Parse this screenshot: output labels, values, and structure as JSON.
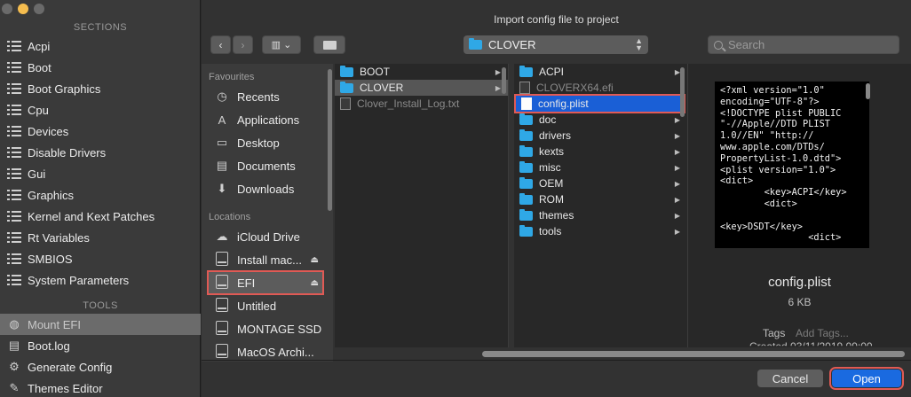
{
  "app_sidebar": {
    "sections_heading": "SECTIONS",
    "sections": [
      "Acpi",
      "Boot",
      "Boot Graphics",
      "Cpu",
      "Devices",
      "Disable Drivers",
      "Gui",
      "Graphics",
      "Kernel and Kext Patches",
      "Rt Variables",
      "SMBIOS",
      "System Parameters"
    ],
    "tools_heading": "TOOLS",
    "tools": [
      {
        "label": "Mount EFI",
        "icon": "disk-icon",
        "selected": true
      },
      {
        "label": "Boot.log",
        "icon": "doc-icon"
      },
      {
        "label": "Generate Config",
        "icon": "gear-icon"
      },
      {
        "label": "Themes Editor",
        "icon": "palette-icon"
      }
    ]
  },
  "dialog": {
    "title": "Import config file to project",
    "path": "CLOVER",
    "search_placeholder": "Search",
    "sidebar": {
      "favourites_heading": "Favourites",
      "favourites": [
        {
          "label": "Recents",
          "icon": "clock-icon"
        },
        {
          "label": "Applications",
          "icon": "apps-icon"
        },
        {
          "label": "Desktop",
          "icon": "desktop-icon"
        },
        {
          "label": "Documents",
          "icon": "documents-icon"
        },
        {
          "label": "Downloads",
          "icon": "downloads-icon"
        }
      ],
      "locations_heading": "Locations",
      "locations": [
        {
          "label": "iCloud Drive",
          "icon": "cloud-icon"
        },
        {
          "label": "Install mac...",
          "icon": "drive-icon",
          "eject": true
        },
        {
          "label": "EFI",
          "icon": "drive-icon",
          "eject": true,
          "selected": true
        },
        {
          "label": "Untitled",
          "icon": "drive-icon"
        },
        {
          "label": "MONTAGE SSD",
          "icon": "drive-icon"
        },
        {
          "label": "MacOS Archi...",
          "icon": "drive-icon"
        }
      ]
    },
    "column1": [
      {
        "name": "BOOT",
        "type": "folder"
      },
      {
        "name": "CLOVER",
        "type": "folder",
        "selected": true
      },
      {
        "name": "Clover_Install_Log.txt",
        "type": "file",
        "dim": true
      }
    ],
    "column2": [
      {
        "name": "ACPI",
        "type": "folder"
      },
      {
        "name": "CLOVERX64.efi",
        "type": "file",
        "dim": true
      },
      {
        "name": "config.plist",
        "type": "file",
        "selected": true
      },
      {
        "name": "doc",
        "type": "folder"
      },
      {
        "name": "drivers",
        "type": "folder"
      },
      {
        "name": "kexts",
        "type": "folder"
      },
      {
        "name": "misc",
        "type": "folder"
      },
      {
        "name": "OEM",
        "type": "folder"
      },
      {
        "name": "ROM",
        "type": "folder"
      },
      {
        "name": "themes",
        "type": "folder"
      },
      {
        "name": "tools",
        "type": "folder"
      }
    ],
    "preview": {
      "code": "<?xml version=\"1.0\"\nencoding=\"UTF-8\"?>\n<!DOCTYPE plist PUBLIC\n\"-//Apple//DTD PLIST\n1.0//EN\" \"http://\nwww.apple.com/DTDs/\nPropertyList-1.0.dtd\">\n<plist version=\"1.0\">\n<dict>\n        <key>ACPI</key>\n        <dict>\n\n<key>DSDT</key>\n                <dict>",
      "name": "config.plist",
      "size": "6 KB",
      "tags_label": "Tags",
      "tags_placeholder": "Add Tags...",
      "created_partial": "Created  03/11/2019 09:00"
    },
    "buttons": {
      "cancel": "Cancel",
      "open": "Open"
    }
  }
}
